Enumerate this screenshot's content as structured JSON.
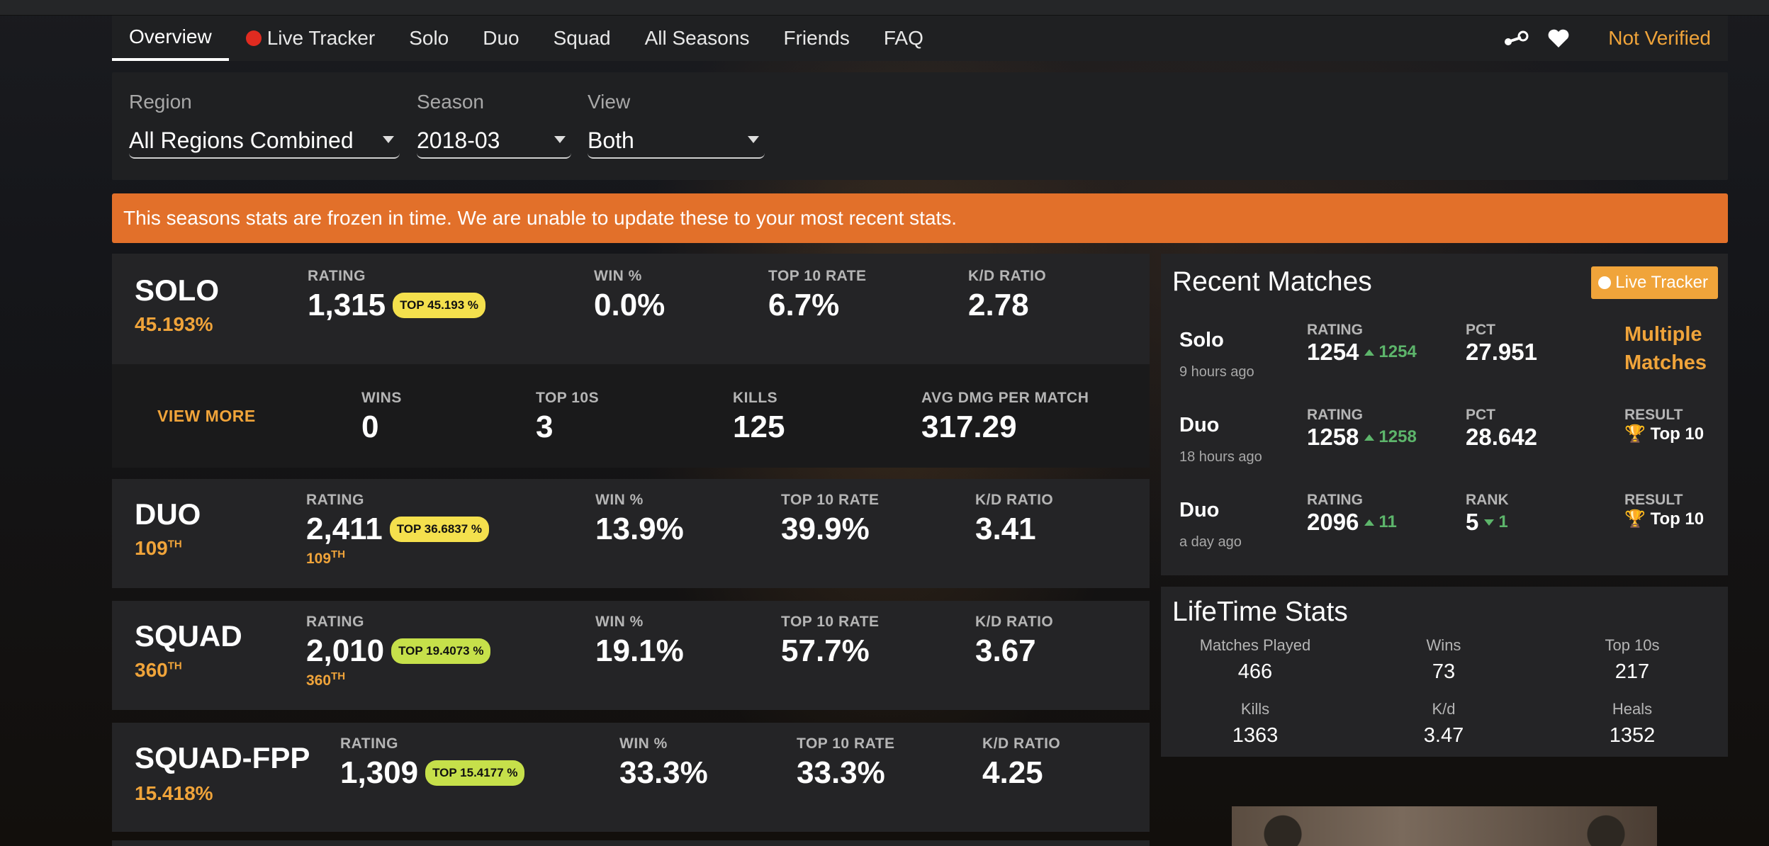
{
  "nav": {
    "tabs": [
      "Overview",
      "Live Tracker",
      "Solo",
      "Duo",
      "Squad",
      "All Seasons",
      "Friends",
      "FAQ"
    ],
    "active_tab": "Overview",
    "steam_icon": "steam-icon",
    "favorite_icon": "heart-icon",
    "not_verified": "Not Verified"
  },
  "filters": {
    "region_label": "Region",
    "region_value": "All Regions Combined",
    "season_label": "Season",
    "season_value": "2018-03",
    "view_label": "View",
    "view_value": "Both"
  },
  "banner": "This seasons stats are frozen in time. We are unable to update these to your most recent stats.",
  "modes": [
    {
      "name": "SOLO",
      "rank": "45.193%",
      "rating_label": "RATING",
      "rating": "1,315",
      "badge": "TOP 45.193 %",
      "win_label": "WIN %",
      "win": "0.0%",
      "top10_label": "TOP 10 RATE",
      "top10": "6.7%",
      "kd_label": "K/D RATIO",
      "kd": "2.78"
    },
    {
      "name": "DUO",
      "rank_num": "109",
      "rank_suffix": "TH",
      "subrank_num": "109",
      "subrank_suffix": "TH",
      "rating_label": "RATING",
      "rating": "2,411",
      "badge": "TOP 36.6837 %",
      "win_label": "WIN %",
      "win": "13.9%",
      "top10_label": "TOP 10 RATE",
      "top10": "39.9%",
      "kd_label": "K/D RATIO",
      "kd": "3.41"
    },
    {
      "name": "SQUAD",
      "rank_num": "360",
      "rank_suffix": "TH",
      "subrank_num": "360",
      "subrank_suffix": "TH",
      "rating_label": "RATING",
      "rating": "2,010",
      "badge": "TOP 19.4073 %",
      "win_label": "WIN %",
      "win": "19.1%",
      "top10_label": "TOP 10 RATE",
      "top10": "57.7%",
      "kd_label": "K/D RATIO",
      "kd": "3.67"
    },
    {
      "name": "SQUAD-FPP",
      "rank": "15.418%",
      "rating_label": "RATING",
      "rating": "1,309",
      "badge": "TOP 15.4177 %",
      "win_label": "WIN %",
      "win": "33.3%",
      "top10_label": "TOP 10 RATE",
      "top10": "33.3%",
      "kd_label": "K/D RATIO",
      "kd": "4.25"
    }
  ],
  "solo_more": {
    "view_more": "VIEW MORE",
    "wins_label": "WINS",
    "wins": "0",
    "top10s_label": "TOP 10S",
    "top10s": "3",
    "kills_label": "KILLS",
    "kills": "125",
    "dmg_label": "AVG DMG PER MATCH",
    "dmg": "317.29"
  },
  "colors": {
    "accent": "#f0a43a",
    "banner": "#e2702a",
    "badge_yellow": "#f4e04d",
    "badge_lime": "#c6e04a",
    "up_green": "#5db56b",
    "live_red": "#e02b20"
  },
  "recent": {
    "title": "Recent Matches",
    "live_button": "Live Tracker",
    "multiple_matches": "Multiple Matches",
    "rows": [
      {
        "mode": "Solo",
        "time": "9 hours ago",
        "rating_label": "RATING",
        "rating": "1254",
        "rating_delta": "1254",
        "c3_label": "PCT",
        "c3_value": "27.951"
      },
      {
        "mode": "Duo",
        "time": "18 hours ago",
        "rating_label": "RATING",
        "rating": "1258",
        "rating_delta": "1258",
        "c3_label": "PCT",
        "c3_value": "28.642",
        "result_label": "RESULT",
        "result": "Top 10"
      },
      {
        "mode": "Duo",
        "time": "a day ago",
        "rating_label": "RATING",
        "rating": "2096",
        "rating_delta": "11",
        "c3_label": "RANK",
        "c3_value": "5",
        "c3_delta": "1",
        "result_label": "RESULT",
        "result": "Top 10"
      }
    ]
  },
  "lifetime": {
    "title": "LifeTime Stats",
    "stats": [
      {
        "label": "Matches Played",
        "value": "466"
      },
      {
        "label": "Wins",
        "value": "73"
      },
      {
        "label": "Top 10s",
        "value": "217"
      },
      {
        "label": "Kills",
        "value": "1363"
      },
      {
        "label": "K/d",
        "value": "3.47"
      },
      {
        "label": "Heals",
        "value": "1352"
      }
    ]
  }
}
